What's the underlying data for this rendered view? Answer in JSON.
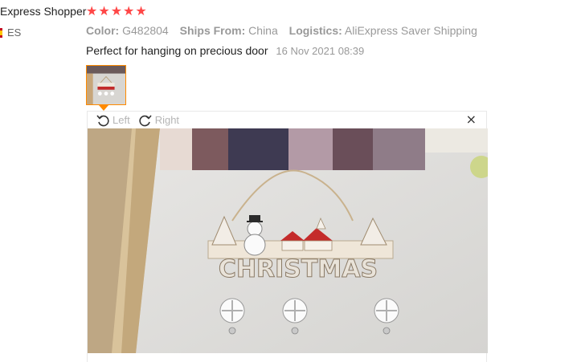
{
  "reviewer": {
    "name": "Express Shopper",
    "country": "ES",
    "rating": 5,
    "stars": [
      "★",
      "★",
      "★",
      "★",
      "★"
    ]
  },
  "meta": {
    "color_label": "Color:",
    "color_value": "G482804",
    "ships_label": "Ships From:",
    "ships_value": "China",
    "logistics_label": "Logistics:",
    "logistics_value": "AliExpress Saver Shipping"
  },
  "review": {
    "text": "Perfect for hanging on precious door",
    "date": "16 Nov 2021 08:39"
  },
  "viewer": {
    "rotate_left_label": "Left",
    "rotate_right_label": "Right",
    "close_symbol": "×",
    "sign_text": "CHRISTMAS"
  },
  "colors": {
    "star": "#ff4747",
    "thumbnail_border": "#ff8a00",
    "label_gray": "#999999"
  }
}
